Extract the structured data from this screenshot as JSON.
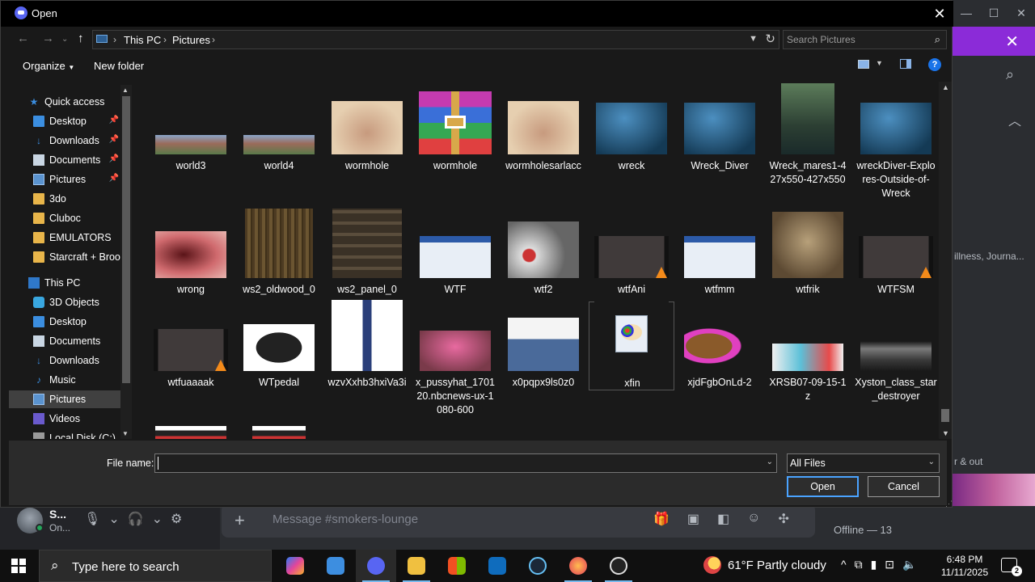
{
  "dialog": {
    "title": "Open",
    "breadcrumb": [
      "This PC",
      "Pictures"
    ],
    "search_placeholder": "Search Pictures",
    "toolbar": {
      "organize": "Organize",
      "new_folder": "New folder",
      "help": "?"
    },
    "nav": [
      {
        "label": "Quick access",
        "icon": "star-icon",
        "pinned": false,
        "indent": 1
      },
      {
        "label": "Desktop",
        "icon": "desktop-icon",
        "pinned": true,
        "indent": 2
      },
      {
        "label": "Downloads",
        "icon": "downloads-icon",
        "pinned": true,
        "indent": 2
      },
      {
        "label": "Documents",
        "icon": "documents-icon",
        "pinned": true,
        "indent": 2
      },
      {
        "label": "Pictures",
        "icon": "pictures-icon",
        "pinned": true,
        "indent": 2
      },
      {
        "label": "3do",
        "icon": "folder-icon",
        "pinned": false,
        "indent": 2
      },
      {
        "label": "Cluboc",
        "icon": "folder-icon",
        "pinned": false,
        "indent": 2
      },
      {
        "label": "EMULATORS",
        "icon": "folder-icon",
        "pinned": false,
        "indent": 2
      },
      {
        "label": "Starcraft + Brood",
        "icon": "folder-icon",
        "pinned": false,
        "indent": 2
      },
      {
        "label": "This PC",
        "icon": "pc-icon",
        "pinned": false,
        "indent": 1
      },
      {
        "label": "3D Objects",
        "icon": "3d-objects-icon",
        "pinned": false,
        "indent": 2
      },
      {
        "label": "Desktop",
        "icon": "desktop-icon",
        "pinned": false,
        "indent": 2
      },
      {
        "label": "Documents",
        "icon": "documents-icon",
        "pinned": false,
        "indent": 2
      },
      {
        "label": "Downloads",
        "icon": "downloads-icon",
        "pinned": false,
        "indent": 2
      },
      {
        "label": "Music",
        "icon": "music-icon",
        "pinned": false,
        "indent": 2
      },
      {
        "label": "Pictures",
        "icon": "pictures-icon",
        "pinned": false,
        "indent": 2,
        "selected": true
      },
      {
        "label": "Videos",
        "icon": "videos-icon",
        "pinned": false,
        "indent": 2
      },
      {
        "label": "Local Disk (C:)",
        "icon": "disk-icon",
        "pinned": false,
        "indent": 2
      }
    ],
    "rows": [
      [
        {
          "lines": [
            "world3"
          ],
          "thumb": "landscape-strip"
        },
        {
          "lines": [
            "world4"
          ],
          "thumb": "landscape-strip"
        },
        {
          "lines": [
            "wormhole"
          ],
          "thumb": "photo-beige"
        },
        {
          "lines": [
            "wormhole"
          ],
          "thumb": "winrar-archive"
        },
        {
          "lines": [
            "wormholesarlacc"
          ],
          "thumb": "photo-beige"
        },
        {
          "lines": [
            "wreck"
          ],
          "thumb": "photo-underwater"
        },
        {
          "lines": [
            "Wreck_Diver"
          ],
          "thumb": "photo-underwater"
        },
        {
          "lines": [
            "Wreck_mares1-4",
            "27x550-427x550"
          ],
          "thumb": "photo-underwater-tall"
        },
        {
          "lines": [
            "wreckDiver-Explo",
            "res-Outside-of-",
            "Wreck"
          ],
          "thumb": "photo-underwater"
        }
      ],
      [
        {
          "lines": [
            "wrong"
          ],
          "thumb": "photo-red"
        },
        {
          "lines": [
            "ws2_oldwood_0"
          ],
          "thumb": "texture-wood"
        },
        {
          "lines": [
            "ws2_panel_0"
          ],
          "thumb": "texture-panel"
        },
        {
          "lines": [
            "WTF"
          ],
          "thumb": "screenshot"
        },
        {
          "lines": [
            "wtf2"
          ],
          "thumb": "photo-sports"
        },
        {
          "lines": [
            "wtfAni"
          ],
          "thumb": "video-vlc"
        },
        {
          "lines": [
            "wtfmm"
          ],
          "thumb": "screenshot"
        },
        {
          "lines": [
            "wtfrik"
          ],
          "thumb": "photo-face"
        },
        {
          "lines": [
            "WTFSM"
          ],
          "thumb": "video-vlc"
        }
      ],
      [
        {
          "lines": [
            "wtfuaaaak"
          ],
          "thumb": "video-vlc"
        },
        {
          "lines": [
            "WTpedal"
          ],
          "thumb": "photo-pedal"
        },
        {
          "lines": [
            "wzvXxhb3hxiVa3i"
          ],
          "thumb": "photo-sword"
        },
        {
          "lines": [
            "x_pussyhat_1701",
            "20.nbcnews-ux-1",
            "080-600"
          ],
          "thumb": "photo-pink"
        },
        {
          "lines": [
            "x0pqpx9ls0z0"
          ],
          "thumb": "document-scan"
        },
        {
          "lines": [
            "xfin"
          ],
          "thumb": "paint-file"
        },
        {
          "lines": [
            "xjdFgbOnLd-2"
          ],
          "thumb": "cartoon"
        },
        {
          "lines": [
            "XRSB07-09-15-1",
            "z"
          ],
          "thumb": "photo-lure"
        },
        {
          "lines": [
            "Xyston_class_star",
            "_destroyer"
          ],
          "thumb": "photo-ship"
        }
      ]
    ],
    "footer": {
      "file_name_label": "File name:",
      "file_name_value": "",
      "file_type": "All Files",
      "open": "Open",
      "cancel": "Cancel"
    }
  },
  "discord": {
    "user_name": "S...",
    "user_status": "On...",
    "message_placeholder": "Message #smokers-lounge",
    "offline_label": "Offline — 13",
    "side_text_1": "illness, Journa...",
    "side_text_2": "r & out"
  },
  "taskbar": {
    "search_placeholder": "Type here to search",
    "weather": "61°F  Partly cloudy",
    "time": "6:48 PM",
    "date": "11/11/2025",
    "notifications": "2"
  },
  "colors": {
    "accent": "#4aa3ff",
    "discord_brand": "#5865f2",
    "discord_bar": "#8b2bd8"
  }
}
